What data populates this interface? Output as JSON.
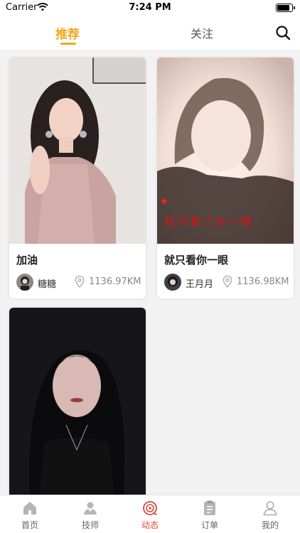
{
  "status_bar": {
    "carrier": "Carrier",
    "time": "7:24 PM"
  },
  "top_nav": {
    "tabs": [
      {
        "label": "推荐",
        "active": true
      },
      {
        "label": "关注",
        "active": false
      }
    ],
    "search_icon": "search-icon"
  },
  "posts": [
    {
      "title": "加油",
      "user": "糖糖",
      "distance": "1136.97KM",
      "image_caption": ""
    },
    {
      "title": "就只看你一眼",
      "user": "王月月",
      "distance": "1136.98KM",
      "image_caption": "就只看了你一眼"
    },
    {
      "title": "",
      "user": "",
      "distance": "",
      "image_caption": ""
    }
  ],
  "tab_bar": {
    "items": [
      {
        "label": "首页",
        "icon": "home-icon"
      },
      {
        "label": "技师",
        "icon": "technician-icon"
      },
      {
        "label": "动态",
        "icon": "moments-icon",
        "active": true
      },
      {
        "label": "订单",
        "icon": "order-icon"
      },
      {
        "label": "我的",
        "icon": "profile-icon"
      }
    ]
  },
  "colors": {
    "accent": "#f0a81c",
    "tab_active": "#d94b3a"
  }
}
